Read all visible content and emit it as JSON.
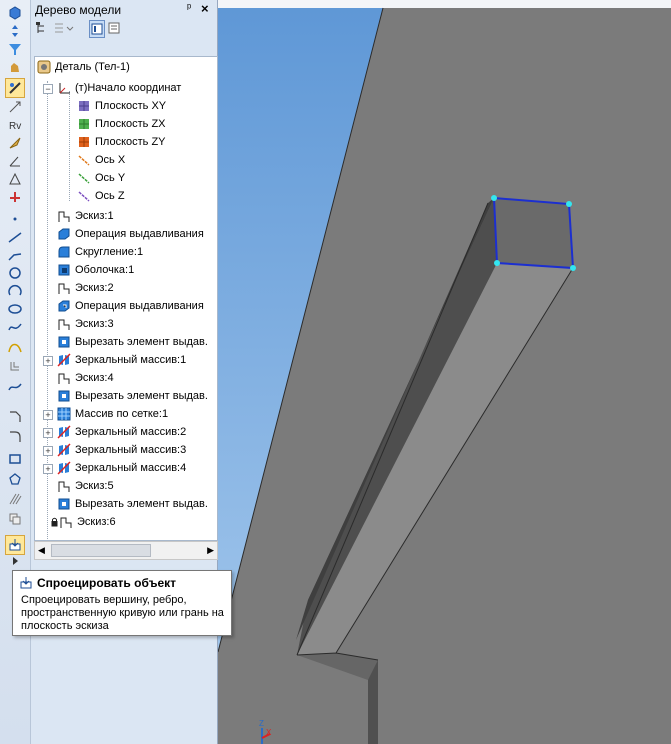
{
  "panel": {
    "title": "Дерево модели",
    "pin": "ₐ",
    "close": "×"
  },
  "tree": {
    "items": [
      {
        "label": "Деталь (Тел-1)",
        "icon": "part-icon"
      },
      {
        "label": "(т)Начало координат",
        "icon": "origin-icon"
      },
      {
        "label": "Плоскость XY",
        "icon": "plane-xy-icon"
      },
      {
        "label": "Плоскость ZX",
        "icon": "plane-zx-icon"
      },
      {
        "label": "Плоскость ZY",
        "icon": "plane-zy-icon"
      },
      {
        "label": "Ось X",
        "icon": "axis-x-icon"
      },
      {
        "label": "Ось Y",
        "icon": "axis-y-icon"
      },
      {
        "label": "Ось Z",
        "icon": "axis-z-icon"
      },
      {
        "label": "Эскиз:1",
        "icon": "sketch-icon"
      },
      {
        "label": "Операция выдавливания",
        "icon": "extrude-icon"
      },
      {
        "label": "Скругление:1",
        "icon": "fillet-icon"
      },
      {
        "label": "Оболочка:1",
        "icon": "shell-icon"
      },
      {
        "label": "Эскиз:2",
        "icon": "sketch-icon"
      },
      {
        "label": "Операция выдавливания",
        "icon": "extrude-icon"
      },
      {
        "label": "Эскиз:3",
        "icon": "sketch-icon"
      },
      {
        "label": "Вырезать элемент выдав.",
        "icon": "cut-extrude-icon"
      },
      {
        "label": "Зеркальный массив:1",
        "icon": "mirror-icon"
      },
      {
        "label": "Эскиз:4",
        "icon": "sketch-icon"
      },
      {
        "label": "Вырезать элемент выдав.",
        "icon": "cut-extrude-icon"
      },
      {
        "label": "Массив по сетке:1",
        "icon": "grid-pattern-icon"
      },
      {
        "label": "Зеркальный массив:2",
        "icon": "mirror-icon"
      },
      {
        "label": "Зеркальный массив:3",
        "icon": "mirror-icon"
      },
      {
        "label": "Зеркальный массив:4",
        "icon": "mirror-icon"
      },
      {
        "label": "Эскиз:5",
        "icon": "sketch-icon"
      },
      {
        "label": "Вырезать элемент выдав.",
        "icon": "cut-extrude-icon"
      },
      {
        "label": "Эскиз:6",
        "icon": "sketch-icon"
      }
    ]
  },
  "tooltip": {
    "title": "Спроецировать объект",
    "description": "Спроецировать вершину, ребро, пространственную кривую или грань на плоскость эскиза"
  },
  "axis_indicator": {
    "z": "Z",
    "x": "X"
  },
  "colors": {
    "selection_edge": "#1c2fd0",
    "vertex": "#33e6f0",
    "viewport_sky": "#6fa6de",
    "model_face": "#7b7b7b"
  }
}
